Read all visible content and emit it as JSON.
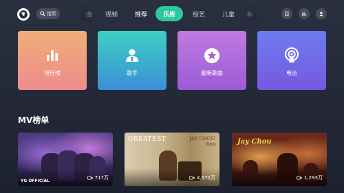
{
  "topbar": {
    "search_label": "搜索",
    "tabs": [
      {
        "label": "出",
        "active": false
      },
      {
        "label": "视频",
        "active": false
      },
      {
        "label": "推荐",
        "active": false,
        "bold": true
      },
      {
        "label": "乐库",
        "active": true
      },
      {
        "label": "综艺",
        "active": false
      },
      {
        "label": "儿童",
        "active": false
      },
      {
        "label": "有",
        "active": false
      }
    ]
  },
  "categories": [
    {
      "label": "排行榜",
      "icon": "chart-bars-icon"
    },
    {
      "label": "歌手",
      "icon": "singer-icon"
    },
    {
      "label": "最新歌曲",
      "icon": "star-disc-icon"
    },
    {
      "label": "电台",
      "icon": "radio-icon"
    }
  ],
  "mv_section": {
    "title": "MV榜单",
    "items": [
      {
        "views": "717万",
        "watermark": "YG OFFICIAL"
      },
      {
        "views": "4,670万",
        "cover_text_left": "GREATEST",
        "cover_text_right": "JAY CHOU",
        "cover_text_sub": "周杰伦"
      },
      {
        "views": "1,293万",
        "cover_text": "Jay Chou"
      }
    ]
  },
  "colors": {
    "accent": "#2bc99c",
    "background": "#262b39"
  }
}
